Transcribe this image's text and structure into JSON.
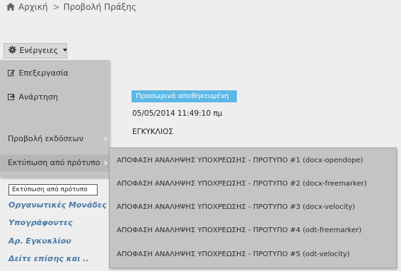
{
  "breadcrumb": {
    "home_label": "Αρχική",
    "separator": ">",
    "current_label": "Προβολή Πράξης"
  },
  "actions": {
    "button_label": "Ενέργειες",
    "menu_items": [
      {
        "label": "Επεξεργασία",
        "icon": "edit-icon"
      },
      {
        "label": "Ανάρτηση",
        "icon": "share-icon"
      },
      {
        "label": "Προβολή εκδόσεων",
        "has_submenu": true
      },
      {
        "label": "Εκτύπωση από πρότυπο",
        "has_submenu": true
      }
    ],
    "print_templates": [
      "ΑΠΟΦΑΣΗ ΑΝΑΛΗΨΗΣ ΥΠΟΧΡΕΩΣΗΣ - ΠΡΟΤΥΠΟ #1 (docx-opendope)",
      "ΑΠΟΦΑΣΗ ΑΝΑΛΗΨΗΣ ΥΠΟΧΡΕΩΣΗΣ - ΠΡΟΤΥΠΟ #2 (docx-freemarker)",
      "ΑΠΟΦΑΣΗ ΑΝΑΛΗΨΗΣ ΥΠΟΧΡΕΩΣΗΣ - ΠΡΟΤΥΠΟ #3 (docx-velocity)",
      "ΑΠΟΦΑΣΗ ΑΝΑΛΗΨΗΣ ΥΠΟΧΡΕΩΣΗΣ - ΠΡΟΤΥΠΟ #4 (odt-freemarker)",
      "ΑΠΟΦΑΣΗ ΑΝΑΛΗΨΗΣ ΥΠΟΧΡΕΩΣΗΣ - ΠΡΟΤΥΠΟ #5 (odt-velocity)"
    ]
  },
  "document": {
    "status": "Προσωρινά αποθηκευμένη",
    "date": "05/05/2014 11:49:10 πμ",
    "type": "ΕΓΚΥΚΛΙΟΣ"
  },
  "tooltip": "Εκτύπωση από πρότυπο",
  "sections": [
    "Οργανωτικές Μονάδες",
    "Υπογράφοντες",
    "Αρ. Εγκυκλίου",
    "Δείτε επίσης και .."
  ],
  "colors": {
    "background": "#eeeeee",
    "menu_background": "#c4c4c4",
    "status_badge": "#5bb7e5",
    "section_link": "#4a7aa5"
  }
}
